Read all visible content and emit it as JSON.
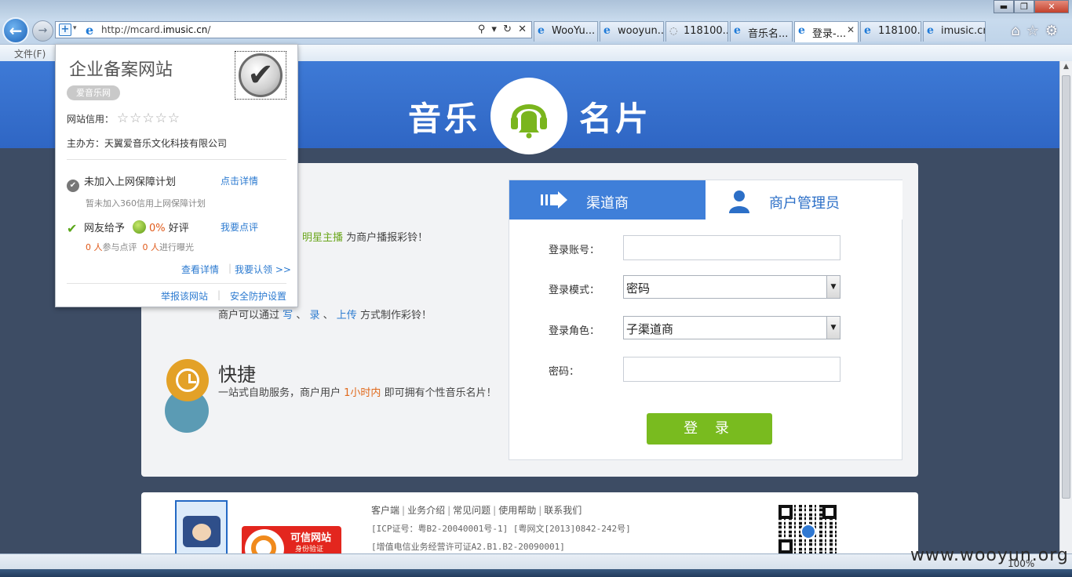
{
  "browser": {
    "url_prefix": "http://mcard.",
    "url_domain": "imusic.cn",
    "url_suffix": "/",
    "address_tools": "⚲ ▾ ↻ ✕",
    "tabs": [
      {
        "label": "WooYu..."
      },
      {
        "label": "wooyun..."
      },
      {
        "label": "118100..."
      },
      {
        "label": "音乐名..."
      },
      {
        "label": "登录-...",
        "close": "✕"
      },
      {
        "label": "118100..."
      },
      {
        "label": "imusic.cn"
      }
    ],
    "menu_file": "文件(F)",
    "window_buttons": {
      "minimize": "▬",
      "maximize": "❐",
      "close": "✕"
    },
    "right_icons": {
      "home": "⌂",
      "favorites": "☆",
      "settings": "⚙"
    },
    "zoom": "100%"
  },
  "popup": {
    "title": "企业备案网站",
    "badge": "爱音乐网",
    "credit_label": "网站信用：",
    "stars": "☆☆☆☆☆",
    "sponsor": "主办方：天翼爱音乐文化科技有限公司",
    "plan_status": "未加入上网保障计划",
    "plan_link": "点击详情",
    "plan_desc": "暂未加入360信用上网保障计划",
    "rating_label": "网友给予",
    "rating_pct": "0%",
    "rating_word": "好评",
    "rating_link": "我要点评",
    "review_count": "0 人",
    "review_text": "参与点评",
    "expose_count": "0 人",
    "expose_text": "进行曝光",
    "view_details": "查看详情",
    "claim": "我要认领 >>",
    "report": "举报该网站",
    "security": "安全防护设置"
  },
  "header": {
    "logo_left": "音乐",
    "logo_right": "名片"
  },
  "features": {
    "f1_highlight": "明星主播",
    "f1_text": "为商户播报彩铃！",
    "f2_prefix": "商户可以通过",
    "f2_w1": "写",
    "f2_sep1": "、",
    "f2_w2": "录",
    "f2_sep2": "、",
    "f2_w3": "上传",
    "f2_suffix": "方式制作彩铃！",
    "f3_title": "快捷",
    "f3_prefix": "一站式自助服务，商户用户",
    "f3_highlight": "1小时内",
    "f3_suffix": "即可拥有个性音乐名片！"
  },
  "login": {
    "tab_channel": "渠道商",
    "tab_admin": "商户管理员",
    "account_label": "登录账号：",
    "account_value": "",
    "mode_label": "登录模式：",
    "mode_value": "密码",
    "role_label": "登录角色：",
    "role_value": "子渠道商",
    "password_label": "密码：",
    "password_value": "",
    "submit": "登 录"
  },
  "footer": {
    "links": [
      "客户端",
      "业务介绍",
      "常见问题",
      "使用帮助",
      "联系我们"
    ],
    "icp": "[ICP证号：粤B2-20040001号-1] [粤网文[2013]0842-242号]",
    "license": "[增值电信业务经营许可证A2.B1.B2-20090001]",
    "trust_title": "可信网站",
    "trust_sub": "身份验证"
  },
  "watermark": "www.wooyun.org"
}
